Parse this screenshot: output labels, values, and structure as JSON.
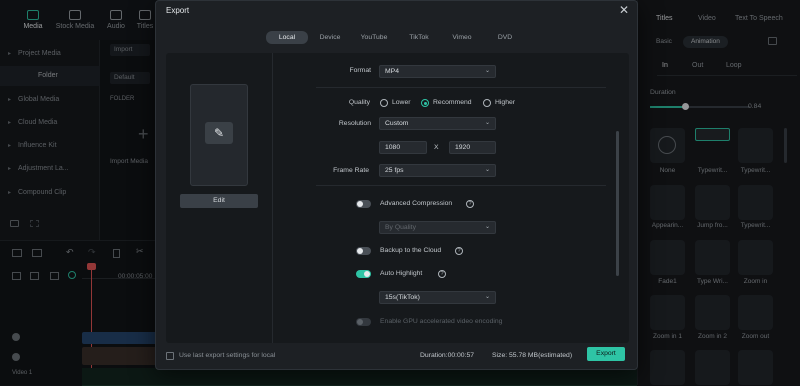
{
  "background_app": {
    "media_tabs": [
      "Media",
      "Stock Media",
      "Audio",
      "Titles"
    ],
    "sidebar_items": [
      "Project Media",
      "Folder",
      "Global Media",
      "Cloud Media",
      "Influence Kit",
      "Adjustment La...",
      "Compound Clip"
    ],
    "media_pane": {
      "import_label": "Import",
      "default_label": "Default",
      "folder_label": "FOLDER",
      "import_media_label": "Import Media"
    },
    "right_panel": {
      "tabs": [
        "Titles",
        "Video",
        "Text To Speech"
      ],
      "pills": [
        "Basic",
        "Animation"
      ],
      "subtabs": [
        "In",
        "Out",
        "Loop"
      ],
      "duration_label": "Duration",
      "duration_value": "0.84",
      "tiles": [
        "None",
        "Typewrit...",
        "Typewrit...",
        "Appearin...",
        "Jump fro...",
        "Typewrit...",
        "Fade1",
        "Type Wri...",
        "Zoom in",
        "Zoom in 1",
        "Zoom in 2",
        "Zoom out"
      ]
    },
    "timeline": {
      "time_label": "00:00:05:00",
      "track_label": "Video 1"
    }
  },
  "dialog": {
    "title": "Export",
    "tabs": [
      "Local",
      "Device",
      "YouTube",
      "TikTok",
      "Vimeo",
      "DVD"
    ],
    "active_tab": "Local",
    "edit_label": "Edit",
    "format_label": "Format",
    "format_value": "MP4",
    "quality_label": "Quality",
    "quality_options": [
      "Lower",
      "Recommend",
      "Higher"
    ],
    "quality_selected": "Recommend",
    "resolution_label": "Resolution",
    "resolution_value": "Custom",
    "width": "1080",
    "x_label": "X",
    "height": "1920",
    "frame_rate_label": "Frame Rate",
    "frame_rate_value": "25 fps",
    "advanced_compression_label": "Advanced Compression",
    "advanced_compression_on": false,
    "by_quality_value": "By Quality",
    "backup_label": "Backup to the Cloud",
    "backup_on": false,
    "auto_highlight_label": "Auto Highlight",
    "auto_highlight_on": true,
    "highlight_duration_value": "15s(TikTok)",
    "gpu_label": "Enable GPU accelerated video encoding",
    "footer_checkbox_label": "Use last export settings for local",
    "duration_text": "Duration:00:00:57",
    "size_text": "Size: 55.78 MB(estimated)",
    "export_button": "Export"
  },
  "colors": {
    "accent": "#2ec4a5",
    "dialog_bg": "#1d2024",
    "body_bg": "#16191c"
  }
}
